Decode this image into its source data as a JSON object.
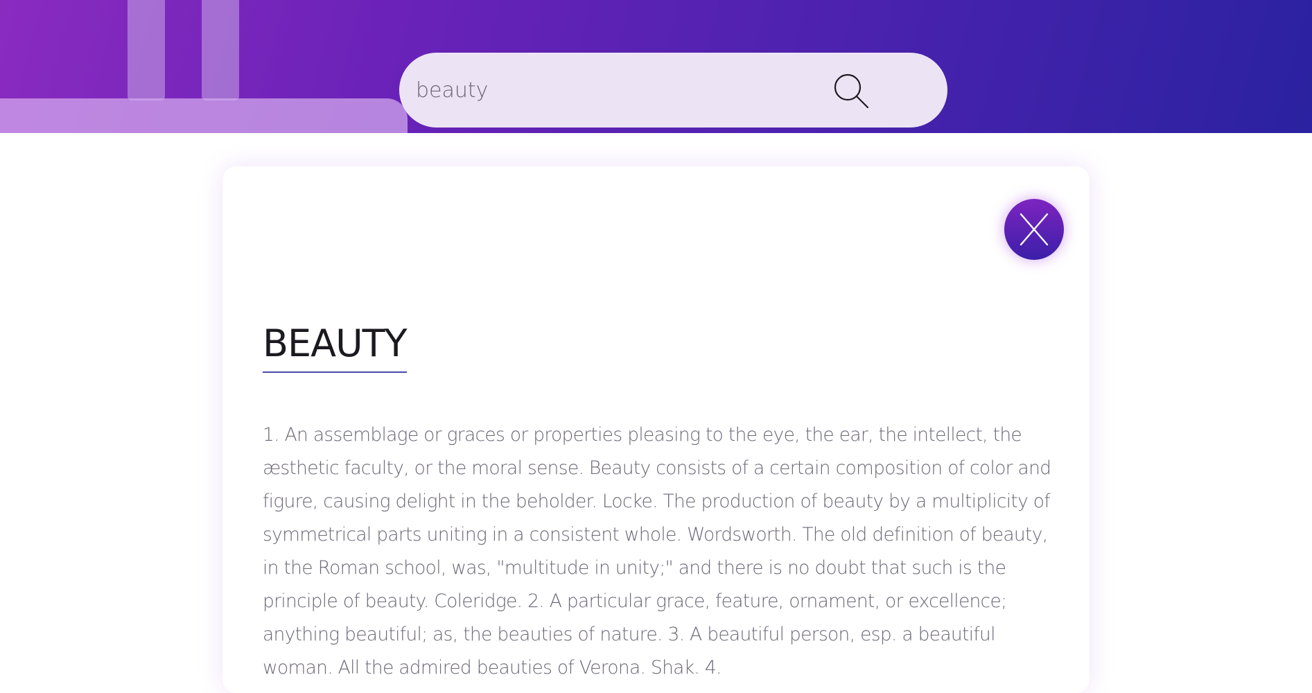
{
  "search": {
    "value": "beauty",
    "icon": "search-icon"
  },
  "card": {
    "close_label": "X",
    "close_icon": "close-icon",
    "title": "BEAUTY",
    "definition": "1. An assemblage or graces or properties pleasing to the eye, the ear, the intellect, the æsthetic faculty, or the moral sense. Beauty consists of a certain composition of color and figure, causing delight in the beholder. Locke. The production of beauty by a multiplicity of symmetrical parts uniting in a consistent whole. Wordsworth. The old definition of beauty, in the Roman school, was, \"multitude in unity;\" and there is no doubt that such is the principle of beauty. Coleridge. 2. A particular grace, feature, ornament, or excellence; anything beautiful; as, the beauties of nature. 3. A beautiful person, esp. a beautiful woman. All the admired beauties of Verona. Shak. 4."
  },
  "colors": {
    "header_gradient_start": "#8a2bc0",
    "header_gradient_end": "#2a22a0",
    "search_bg": "#ece4f4",
    "close_button": "#5a20b4",
    "title_underline": "#4848a8",
    "body_text": "#6b6676"
  }
}
